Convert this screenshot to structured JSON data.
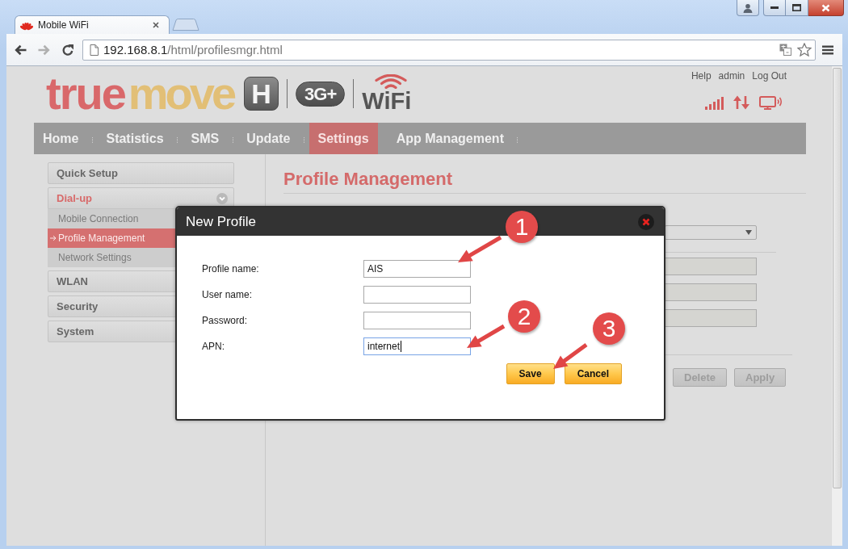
{
  "browser": {
    "tabs": [
      {
        "title": "Mobile WiFi",
        "selected": true
      }
    ],
    "back": {
      "disabled": false
    },
    "forward": {
      "disabled": true
    },
    "url": {
      "host": "192.168.8.1",
      "path": "/html/profilesmgr.html"
    }
  },
  "header": {
    "logo": {
      "wordmark": [
        "true",
        "move"
      ],
      "badge": "H",
      "network": "3G+",
      "wifi": "WiFi"
    },
    "links": [
      "Help",
      "admin",
      "Log Out"
    ]
  },
  "nav": [
    {
      "label": "Home",
      "selected": false
    },
    {
      "label": "Statistics",
      "selected": false
    },
    {
      "label": "SMS",
      "selected": false
    },
    {
      "label": "Update",
      "selected": false
    },
    {
      "label": "Settings",
      "selected": true
    },
    {
      "label": "App Management",
      "selected": false
    }
  ],
  "sidebar": [
    {
      "label": "Quick Setup",
      "expanded": false
    },
    {
      "label": "Dial-up",
      "expanded": true,
      "children": [
        {
          "label": "Mobile Connection",
          "selected": false
        },
        {
          "label": "Profile Management",
          "selected": true
        },
        {
          "label": "Network Settings",
          "selected": false
        }
      ]
    },
    {
      "label": "WLAN",
      "expanded": false
    },
    {
      "label": "Security",
      "expanded": false
    },
    {
      "label": "System",
      "expanded": false
    }
  ],
  "main": {
    "title": "Profile Management",
    "fields": [
      {
        "disabled": true
      },
      {
        "disabled": true
      },
      {
        "disabled": true
      }
    ],
    "buttons": [
      {
        "label": "Delete",
        "disabled": true
      },
      {
        "label": "Apply",
        "disabled": true
      }
    ]
  },
  "dialog": {
    "title": "New Profile",
    "fields": [
      {
        "label": "Profile name:",
        "value": "AIS",
        "focused": false
      },
      {
        "label": "User name:",
        "focused": false
      },
      {
        "label": "Password:",
        "focused": false
      },
      {
        "label": "APN:",
        "value": "internet",
        "focused": true
      }
    ],
    "buttons": [
      "Save",
      "Cancel"
    ]
  },
  "callouts": [
    {
      "number": "1"
    },
    {
      "number": "2"
    },
    {
      "number": "3"
    }
  ]
}
